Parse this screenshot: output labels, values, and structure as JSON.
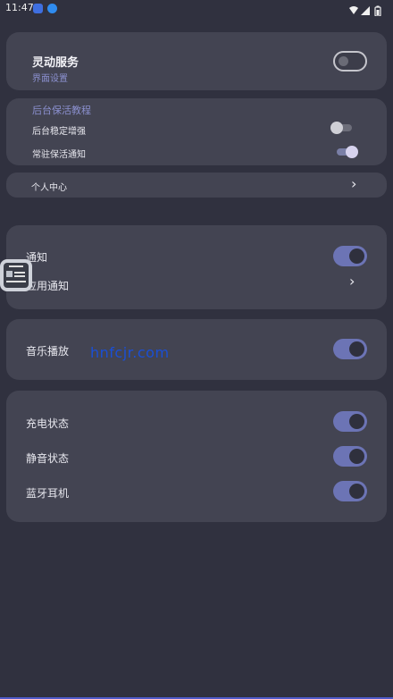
{
  "status_bar": {
    "time": "11:47",
    "icons": [
      "app-notification-icon",
      "download-icon",
      "wifi-icon",
      "signal-icon",
      "battery-icon"
    ]
  },
  "top_card": {
    "title": "灵动服务",
    "subtitle": "界面设置",
    "toggle_on": false
  },
  "keepalive": {
    "heading": "后台保活教程",
    "items": [
      {
        "label": "后台稳定增强",
        "on": false
      },
      {
        "label": "常驻保活通知",
        "on": true
      }
    ]
  },
  "personal_center": {
    "label": "个人中心"
  },
  "notification_card": {
    "notify_label": "通知",
    "notify_on": true,
    "app_notify_label": "应用通知"
  },
  "music_card": {
    "label": "音乐播放",
    "on": true
  },
  "watermark": "hnfcjr.com",
  "status_card": {
    "items": [
      {
        "label": "充电状态",
        "on": true
      },
      {
        "label": "静音状态",
        "on": true
      },
      {
        "label": "蓝牙耳机",
        "on": true
      }
    ]
  },
  "colors": {
    "background": "#30313f",
    "card": "#434452",
    "accent": "#6c74b5",
    "accent_text": "#8b90cf"
  }
}
